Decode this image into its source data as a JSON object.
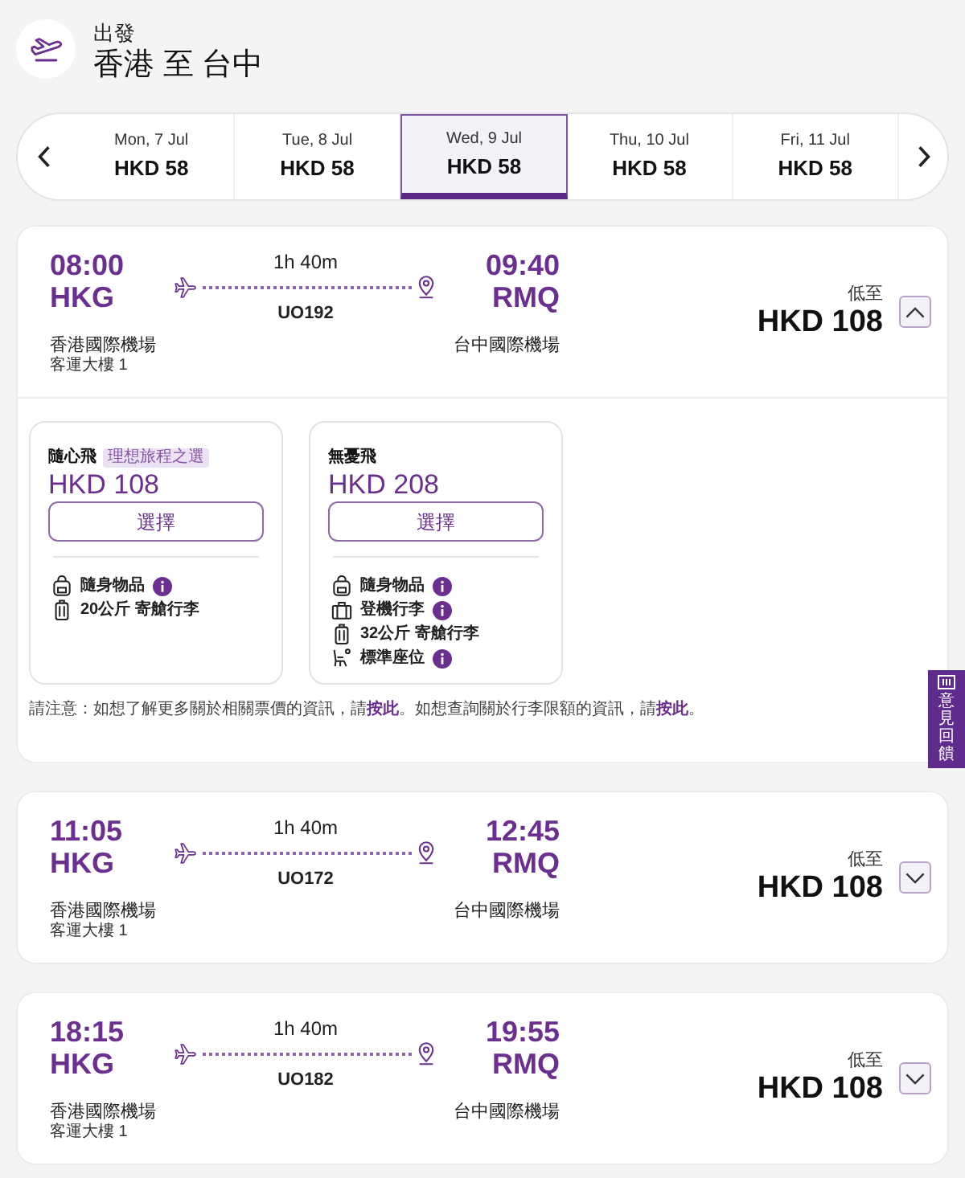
{
  "header": {
    "label": "出發",
    "route": "香港 至 台中"
  },
  "date_tabs": [
    {
      "day": "Mon, 7 Jul",
      "price": "HKD 58",
      "selected": false
    },
    {
      "day": "Tue, 8 Jul",
      "price": "HKD 58",
      "selected": false
    },
    {
      "day": "Wed, 9 Jul",
      "price": "HKD 58",
      "selected": true
    },
    {
      "day": "Thu, 10 Jul",
      "price": "HKD 58",
      "selected": false
    },
    {
      "day": "Fri, 11 Jul",
      "price": "HKD 58",
      "selected": false
    }
  ],
  "flights": [
    {
      "departure_time": "08:00",
      "departure_code": "HKG",
      "departure_airport": "香港國際機場",
      "departure_terminal": "客運大樓 1",
      "duration": "1h 40m",
      "flight_number": "UO192",
      "arrival_time": "09:40",
      "arrival_code": "RMQ",
      "arrival_airport": "台中國際機場",
      "price_label": "低至",
      "price": "HKD 108",
      "expanded": true,
      "fares": [
        {
          "name": "隨心飛",
          "badge": "理想旅程之選",
          "price": "HKD 108",
          "button": "選擇",
          "features": [
            {
              "kind": "personal_item",
              "text": "隨身物品",
              "info": true
            },
            {
              "kind": "checked_bag",
              "text": "20公斤 寄艙行李",
              "info": false
            }
          ]
        },
        {
          "name": "無憂飛",
          "price": "HKD 208",
          "button": "選擇",
          "features": [
            {
              "kind": "personal_item",
              "text": "隨身物品",
              "info": true
            },
            {
              "kind": "cabin_bag",
              "text": "登機行李",
              "info": true
            },
            {
              "kind": "checked_bag",
              "text": "32公斤 寄艙行李",
              "info": false
            },
            {
              "kind": "seat",
              "text": "標準座位",
              "info": true
            }
          ]
        }
      ],
      "note": [
        {
          "kind": "text",
          "text": "請注意：如想了解更多關於相關票價的資訊，請"
        },
        {
          "kind": "link",
          "text": "按此"
        },
        {
          "kind": "text",
          "text": "。如想查詢關於行李限額的資訊，請"
        },
        {
          "kind": "link",
          "text": "按此"
        },
        {
          "kind": "text",
          "text": "。"
        }
      ]
    },
    {
      "departure_time": "11:05",
      "departure_code": "HKG",
      "departure_airport": "香港國際機場",
      "departure_terminal": "客運大樓 1",
      "duration": "1h 40m",
      "flight_number": "UO172",
      "arrival_time": "12:45",
      "arrival_code": "RMQ",
      "arrival_airport": "台中國際機場",
      "price_label": "低至",
      "price": "HKD 108",
      "expanded": false
    },
    {
      "departure_time": "18:15",
      "departure_code": "HKG",
      "departure_airport": "香港國際機場",
      "departure_terminal": "客運大樓 1",
      "duration": "1h 40m",
      "flight_number": "UO182",
      "arrival_time": "19:55",
      "arrival_code": "RMQ",
      "arrival_airport": "台中國際機場",
      "price_label": "低至",
      "price": "HKD 108",
      "expanded": false
    }
  ],
  "feedback_tab": {
    "label": "意見回饋"
  }
}
